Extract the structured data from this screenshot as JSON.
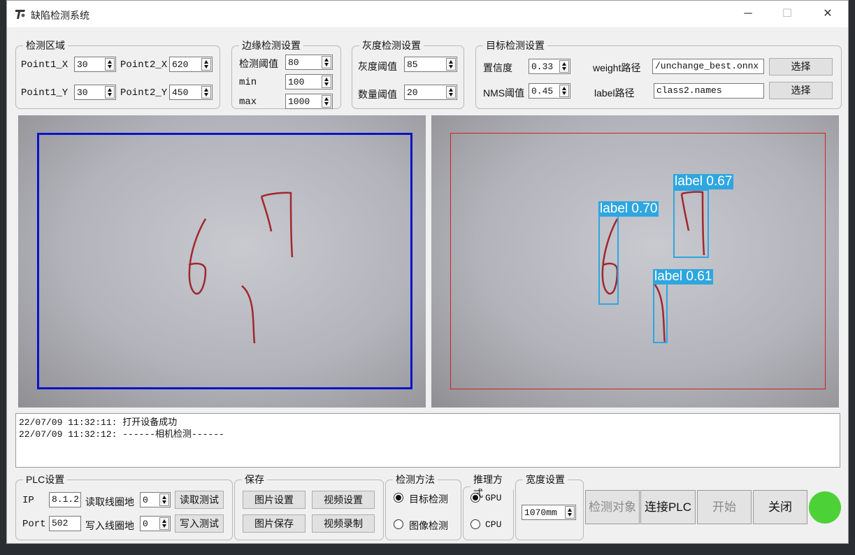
{
  "window": {
    "title": "缺陷检测系统",
    "minimize": "─",
    "maximize": "☐",
    "close": "✕"
  },
  "region": {
    "legend": "检测区域",
    "p1x_label": "Point1_X",
    "p1x": "30",
    "p2x_label": "Point2_X",
    "p2x": "620",
    "p1y_label": "Point1_Y",
    "p1y": "30",
    "p2y_label": "Point2_Y",
    "p2y": "450"
  },
  "edge": {
    "legend": "边缘检测设置",
    "threshold_label": "检测阈值",
    "threshold": "80",
    "min_label": "min",
    "min": "100",
    "max_label": "max",
    "max": "1000"
  },
  "gray": {
    "legend": "灰度检测设置",
    "threshold_label": "灰度阈值",
    "threshold": "85",
    "count_label": "数量阈值",
    "count": "20"
  },
  "target": {
    "legend": "目标检测设置",
    "conf_label": "置信度",
    "conf": "0.33",
    "nms_label": "NMS阈值",
    "nms": "0.45",
    "weight_label": "weight路径",
    "weight_path": "/unchange_best.onnx",
    "label_label": "label路径",
    "label_path": "class2.names",
    "choose_weight": "选择",
    "choose_label": "选择"
  },
  "detections": [
    {
      "text": "label 0.67"
    },
    {
      "text": "label 0.70"
    },
    {
      "text": "label 0.61"
    }
  ],
  "log": [
    "22/07/09 11:32:11: 打开设备成功",
    "22/07/09 11:32:12: ------相机检测------"
  ],
  "plc": {
    "legend": "PLC设置",
    "ip_label": "IP",
    "ip": "8.1.2",
    "port_label": "Port",
    "port": "502",
    "read_label": "读取线圈地",
    "read_addr": "0",
    "read_test": "读取测试",
    "write_label": "写入线圈地",
    "write_addr": "0",
    "write_test": "写入测试"
  },
  "save": {
    "legend": "保存",
    "image_settings": "图片设置",
    "video_settings": "视频设置",
    "image_save": "图片保存",
    "video_record": "视频录制"
  },
  "method": {
    "legend": "检测方法",
    "option1": "目标检测",
    "option2": "图像检测",
    "selected": "目标检测"
  },
  "inference": {
    "legend": "推理方式",
    "option1": "GPU",
    "option2": "CPU",
    "selected": "GPU"
  },
  "width": {
    "legend": "宽度设置",
    "value": "1070mm"
  },
  "actions": {
    "detect_object": "检测对象",
    "connect_plc": "连接PLC",
    "start": "开始",
    "close": "关闭"
  },
  "status": {
    "color": "#4cd137"
  },
  "colors": {
    "roi_left": "#0a14c8",
    "roi_right": "#d02020",
    "detection": "#2ea6df"
  }
}
